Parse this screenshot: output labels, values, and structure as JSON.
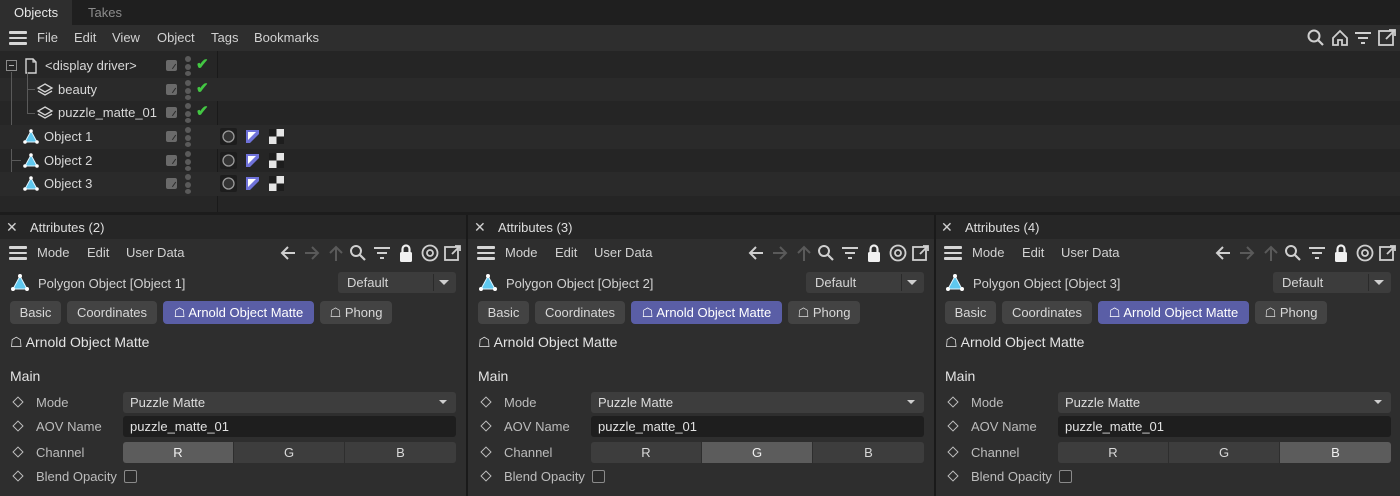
{
  "objects_manager": {
    "tabs": [
      "Objects",
      "Takes"
    ],
    "active_tab": "Objects",
    "menu": [
      "File",
      "Edit",
      "View",
      "Object",
      "Tags",
      "Bookmarks"
    ],
    "toolbar_icons": [
      "search-icon",
      "home-icon",
      "filter-icon",
      "new-window-icon"
    ],
    "tree": [
      {
        "label": "<display driver>",
        "icon": "document-icon",
        "depth": 0,
        "expanded": true,
        "checked": true
      },
      {
        "label": "beauty",
        "icon": "layers-icon",
        "depth": 1,
        "checked": true
      },
      {
        "label": "puzzle_matte_01",
        "icon": "layers-icon",
        "depth": 1,
        "checked": true
      },
      {
        "label": "Object 1",
        "icon": "polygon-object-icon",
        "depth": 0,
        "tags": [
          "sphere-tag",
          "arnold-tag",
          "checker-tag"
        ]
      },
      {
        "label": "Object 2",
        "icon": "polygon-object-icon",
        "depth": 0,
        "tags": [
          "sphere-tag",
          "arnold-tag",
          "checker-tag"
        ]
      },
      {
        "label": "Object 3",
        "icon": "polygon-object-icon",
        "depth": 0,
        "tags": [
          "sphere-tag",
          "arnold-tag",
          "checker-tag"
        ]
      }
    ]
  },
  "attribute_panels": [
    {
      "title": "Attributes (2)",
      "menu": [
        "Mode",
        "Edit",
        "User Data"
      ],
      "object_label": "Polygon Object [Object 1]",
      "mode_dropdown": "Default",
      "tabs": [
        "Basic",
        "Coordinates",
        "☖ Arnold Object Matte",
        "☖ Phong"
      ],
      "active_tab_index": 2,
      "section_title": "☖ Arnold Object Matte",
      "group_title": "Main",
      "params": {
        "mode_label": "Mode",
        "mode_value": "Puzzle Matte",
        "aov_label": "AOV Name",
        "aov_value": "puzzle_matte_01",
        "channel_label": "Channel",
        "channels": [
          "R",
          "G",
          "B"
        ],
        "channel_active": "R",
        "blend_label": "Blend Opacity",
        "blend_checked": false
      }
    },
    {
      "title": "Attributes (3)",
      "menu": [
        "Mode",
        "Edit",
        "User Data"
      ],
      "object_label": "Polygon Object [Object 2]",
      "mode_dropdown": "Default",
      "tabs": [
        "Basic",
        "Coordinates",
        "☖ Arnold Object Matte",
        "☖ Phong"
      ],
      "active_tab_index": 2,
      "section_title": "☖ Arnold Object Matte",
      "group_title": "Main",
      "params": {
        "mode_label": "Mode",
        "mode_value": "Puzzle Matte",
        "aov_label": "AOV Name",
        "aov_value": "puzzle_matte_01",
        "channel_label": "Channel",
        "channels": [
          "R",
          "G",
          "B"
        ],
        "channel_active": "G",
        "blend_label": "Blend Opacity",
        "blend_checked": false
      }
    },
    {
      "title": "Attributes (4)",
      "menu": [
        "Mode",
        "Edit",
        "User Data"
      ],
      "object_label": "Polygon Object [Object 3]",
      "mode_dropdown": "Default",
      "tabs": [
        "Basic",
        "Coordinates",
        "☖ Arnold Object Matte",
        "☖ Phong"
      ],
      "active_tab_index": 2,
      "section_title": "☖ Arnold Object Matte",
      "group_title": "Main",
      "params": {
        "mode_label": "Mode",
        "mode_value": "Puzzle Matte",
        "aov_label": "AOV Name",
        "aov_value": "puzzle_matte_01",
        "channel_label": "Channel",
        "channels": [
          "R",
          "G",
          "B"
        ],
        "channel_active": "B",
        "blend_label": "Blend Opacity",
        "blend_checked": false
      }
    }
  ],
  "colors": {
    "active_tab": "#5a5ea6",
    "check_green": "#43c743",
    "object_icon": "#5fc8ef",
    "arnold_tag": "#6f72d9"
  }
}
